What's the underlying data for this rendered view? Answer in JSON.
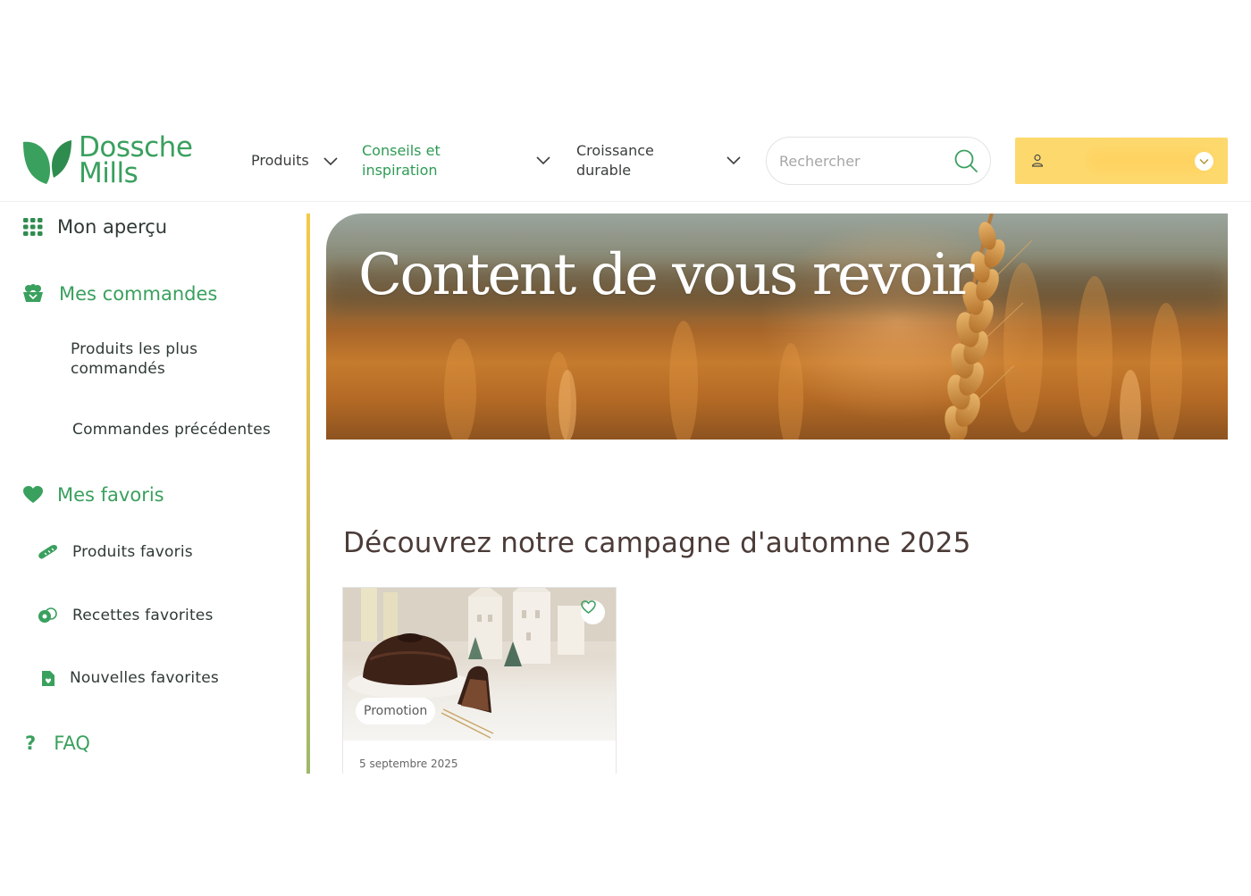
{
  "header": {
    "logo": {
      "line1": "Dossche",
      "line2": "Mills",
      "icon": "leaf-logo-icon"
    },
    "nav": [
      {
        "label": "Produits",
        "icon": "chevron-down-icon"
      },
      {
        "label": "Conseils et inspiration",
        "icon": "chevron-down-icon",
        "active": true
      },
      {
        "label": "Croissance durable",
        "icon": "chevron-down-icon"
      }
    ],
    "search": {
      "placeholder": "Rechercher",
      "value": "",
      "icon": "search-icon"
    },
    "account": {
      "icon": "user-icon",
      "name": "",
      "dropdown_icon": "chevron-down-icon"
    }
  },
  "sidebar": {
    "overview": {
      "label": "Mon aperçu",
      "icon": "grid-icon"
    },
    "orders": {
      "label": "Mes commandes",
      "icon": "basket-icon"
    },
    "orders_items": [
      {
        "label": "Produits les plus commandés"
      },
      {
        "label": "Commandes précédentes"
      }
    ],
    "favorites": {
      "label": "Mes favoris",
      "icon": "heart-icon"
    },
    "favorites_items": [
      {
        "label": "Produits favoris",
        "icon": "bread-icon"
      },
      {
        "label": "Recettes favorites",
        "icon": "recipe-icon"
      },
      {
        "label": "Nouvelles favorites",
        "icon": "news-icon"
      }
    ],
    "faq": {
      "label": "FAQ",
      "icon": "question-icon"
    }
  },
  "hero": {
    "title": "Content de vous revoir"
  },
  "campaign": {
    "title": "Découvrez notre campagne d'automne 2025",
    "card": {
      "badge": "Promotion",
      "date": "5 septembre 2025",
      "fav_icon": "heart-outline-icon"
    }
  },
  "colors": {
    "brand_green": "#3aa05e",
    "account_yellow": "#fdd96d",
    "title_brown": "#4b3b37"
  }
}
